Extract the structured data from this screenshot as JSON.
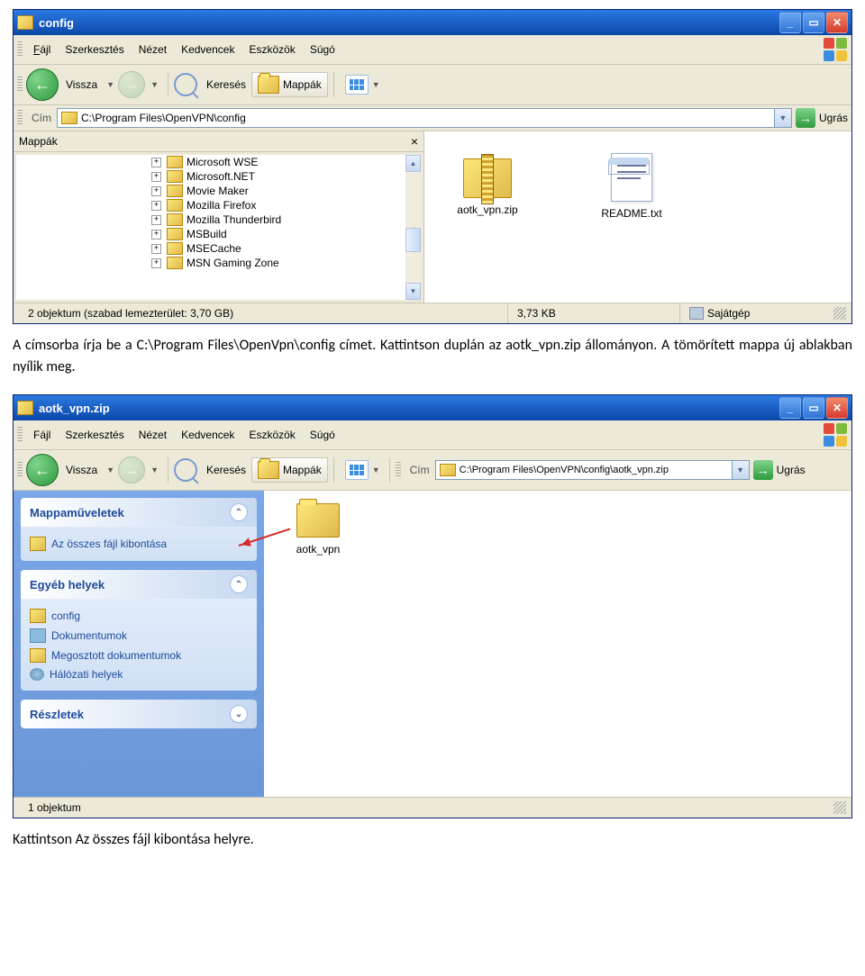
{
  "win1": {
    "title": "config",
    "menu": {
      "file": "Fájl",
      "edit": "Szerkesztés",
      "view": "Nézet",
      "fav": "Kedvencek",
      "tools": "Eszközök",
      "help": "Súgó"
    },
    "toolbar": {
      "back": "Vissza",
      "search": "Keresés",
      "folders": "Mappák"
    },
    "addr": {
      "label": "Cím",
      "path": "C:\\Program Files\\OpenVPN\\config",
      "go": "Ugrás"
    },
    "folders_panel": {
      "title": "Mappák"
    },
    "tree": [
      "Microsoft WSE",
      "Microsoft.NET",
      "Movie Maker",
      "Mozilla Firefox",
      "Mozilla Thunderbird",
      "MSBuild",
      "MSECache",
      "MSN Gaming Zone"
    ],
    "files": {
      "zip": "aotk_vpn.zip",
      "readme": "README.txt"
    },
    "status": {
      "left": "2 objektum   (szabad lemezterület: 3,70 GB)",
      "size": "3,73 KB",
      "loc": "Sajátgép"
    }
  },
  "caption1": "A címsorba írja be a C:\\Program Files\\OpenVpn\\config címet. Kattintson duplán az aotk_vpn.zip állományon. A tömörített mappa új ablakban nyílik meg.",
  "win2": {
    "title": "aotk_vpn.zip",
    "menu_same": true,
    "addr": {
      "label": "Cím",
      "path": "C:\\Program Files\\OpenVPN\\config\\aotk_vpn.zip",
      "go": "Ugrás"
    },
    "toolbar": {
      "back": "Vissza",
      "search": "Keresés",
      "folders": "Mappák"
    },
    "tasks": {
      "ops": {
        "title": "Mappaműveletek",
        "extract": "Az összes fájl kibontása"
      },
      "other": {
        "title": "Egyéb helyek",
        "items": [
          "config",
          "Dokumentumok",
          "Megosztott dokumentumok",
          "Hálózati helyek"
        ]
      },
      "details": {
        "title": "Részletek"
      }
    },
    "files": {
      "folder": "aotk_vpn"
    },
    "status": {
      "left": "1 objektum"
    }
  },
  "caption2": "Kattintson Az összes fájl kibontása helyre."
}
